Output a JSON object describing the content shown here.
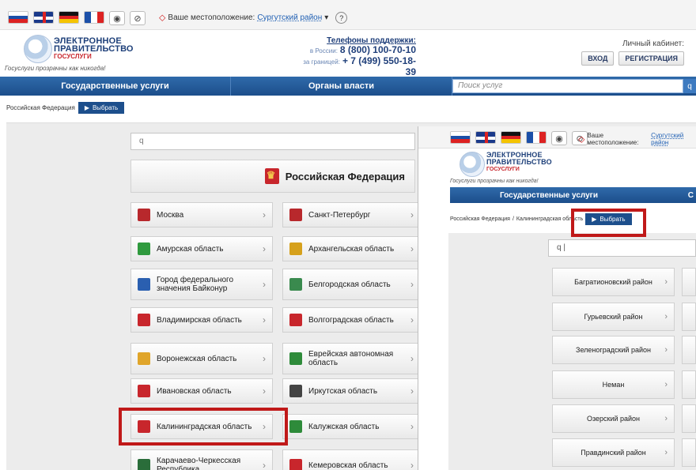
{
  "location": {
    "label": "Ваше местоположение:",
    "value": "Сургутский район",
    "help": "?"
  },
  "brand": {
    "line1": "ЭЛЕКТРОННОЕ",
    "line2": "ПРАВИТЕЛЬСТВО",
    "line3": "ГОСУСЛУГИ",
    "slogan": "Госуслуги прозрачны как никогда!"
  },
  "support": {
    "title": "Телефоны поддержки:",
    "russia_label": "в России:",
    "russia_phone": "8 (800) 100-70-10",
    "abroad_label": "за границей:",
    "abroad_phone": "+ 7 (499) 550-18-39"
  },
  "account": {
    "title": "Личный кабинет:",
    "login": "ВХОД",
    "register": "РЕГИСТРАЦИЯ"
  },
  "nav": {
    "services": "Государственные услуги",
    "authorities": "Органы власти",
    "search_placeholder": "Поиск услуг",
    "search_btn": "q"
  },
  "breadcrumb": {
    "root": "Российская Федерация",
    "select": "Выбрать"
  },
  "main": {
    "search_icon": "q",
    "federation": "Российская Федерация",
    "regions": [
      {
        "name": "Москва",
        "icon_color": "#b8282c"
      },
      {
        "name": "Санкт-Петербург",
        "icon_color": "#b8282c"
      },
      {
        "name": "Амурская область",
        "icon_color": "#2f9a3e"
      },
      {
        "name": "Архангельская область",
        "icon_color": "#d6a11c"
      },
      {
        "name": "Город федерального значения Байконур",
        "icon_color": "#2a5fb0"
      },
      {
        "name": "Белгородская область",
        "icon_color": "#3a8a4e"
      },
      {
        "name": "Владимирская область",
        "icon_color": "#c8262c"
      },
      {
        "name": "Волгоградская область",
        "icon_color": "#c8262c"
      },
      {
        "name": "Воронежская область",
        "icon_color": "#e0a52a"
      },
      {
        "name": "Еврейская автономная область",
        "icon_color": "#2e8b3a"
      },
      {
        "name": "Ивановская область",
        "icon_color": "#c8262c"
      },
      {
        "name": "Иркутская область",
        "icon_color": "#444444"
      },
      {
        "name": "Калининградская область",
        "icon_color": "#c8262c"
      },
      {
        "name": "Калужская область",
        "icon_color": "#2e8b3a"
      },
      {
        "name": "Карачаево-Черкесская Республика",
        "icon_color": "#2a6d3a"
      },
      {
        "name": "Кемеровская область",
        "icon_color": "#c8262c"
      }
    ]
  },
  "overlay": {
    "location_label": "Ваше местоположение:",
    "location_value": "Сургутский район",
    "brand_line1": "ЭЛЕКТРОННОЕ",
    "brand_line2": "ПРАВИТЕЛЬСТВО",
    "brand_line3": "ГОСУСЛУГИ",
    "slogan": "Госуслуги прозрачны как никогда!",
    "nav_services": "Государственные услуги",
    "nav_more": "С",
    "crumb_root": "Российская Федерация",
    "crumb_region": "Калининградская область",
    "select": "Выбрать",
    "search_value": "q |",
    "districts": [
      "Багратионовский район",
      "Гурьевский район",
      "Зеленоградский район",
      "Неман",
      "Озерский район",
      "Правдинский район"
    ]
  },
  "colors": {
    "nav_blue": "#1c4e8b",
    "highlight_red": "#c01919",
    "pin_red": "#d21f1f",
    "link_blue": "#1f5fb3"
  }
}
